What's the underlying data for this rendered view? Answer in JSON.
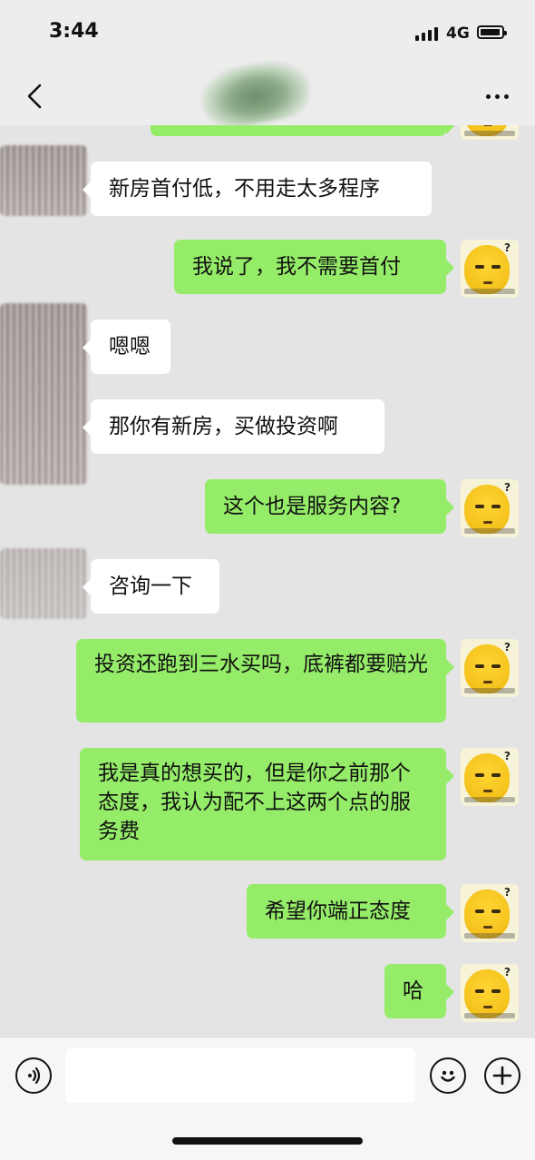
{
  "status_bar": {
    "time": "3:44",
    "network": "4G",
    "signal_icon": "signal-bars-icon",
    "battery_icon": "battery-icon"
  },
  "nav_bar": {
    "back_icon": "chevron-left-icon",
    "more_icon": "more-dots-icon"
  },
  "messages": [
    {
      "side": "left",
      "text": "新房首付低，不用走太多程序"
    },
    {
      "side": "right",
      "text": "我说了，我不需要首付"
    },
    {
      "side": "left",
      "text": "嗯嗯"
    },
    {
      "side": "left",
      "text": "那你有新房，买做投资啊"
    },
    {
      "side": "right",
      "text": "这个也是服务内容?"
    },
    {
      "side": "left",
      "text": "咨询一下"
    },
    {
      "side": "right",
      "text": " 投资还跑到三水买吗，底裤都要赔光"
    },
    {
      "side": "right",
      "text": "我是真的想买的，但是你之前那个态度，我认为配不上这两个点的服务费"
    },
    {
      "side": "right",
      "text": "希望你端正态度"
    },
    {
      "side": "right",
      "text": "哈"
    }
  ],
  "input_bar": {
    "voice_icon": "voice-icon",
    "emoji_icon": "emoji-icon",
    "plus_icon": "plus-icon",
    "message_value": ""
  }
}
